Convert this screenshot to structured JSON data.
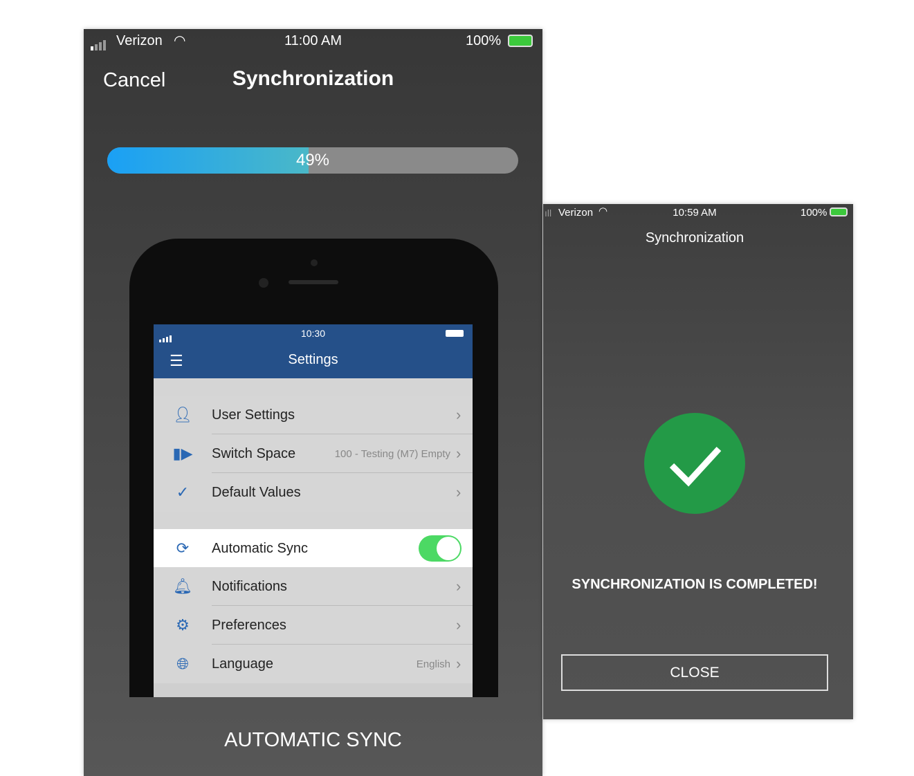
{
  "left": {
    "status": {
      "carrier": "Verizon",
      "time": "11:00 AM",
      "battery": "100%"
    },
    "nav": {
      "cancel": "Cancel",
      "title": "Synchronization"
    },
    "progress": {
      "percent": 49,
      "label": "49%"
    },
    "caption": "AUTOMATIC SYNC",
    "inner_phone": {
      "status_time": "10:30",
      "title": "Settings",
      "rows": [
        {
          "label": "User Settings",
          "value": "",
          "icon": "user-icon"
        },
        {
          "label": "Switch Space",
          "value": "100 - Testing (M7) Empty",
          "icon": "switch-space-icon"
        },
        {
          "label": "Default Values",
          "value": "",
          "icon": "check-icon"
        },
        {
          "label": "Automatic Sync",
          "value": "",
          "icon": "sync-icon",
          "toggle": true
        },
        {
          "label": "Notifications",
          "value": "",
          "icon": "bell-icon"
        },
        {
          "label": "Preferences",
          "value": "",
          "icon": "gear-icon"
        },
        {
          "label": "Language",
          "value": "English",
          "icon": "globe-icon"
        }
      ]
    }
  },
  "right": {
    "status": {
      "carrier": "Verizon",
      "time": "10:59 AM",
      "battery": "100%"
    },
    "title": "Synchronization",
    "message": "SYNCHRONIZATION IS COMPLETED!",
    "close_label": "CLOSE",
    "success_color": "#239a47"
  }
}
